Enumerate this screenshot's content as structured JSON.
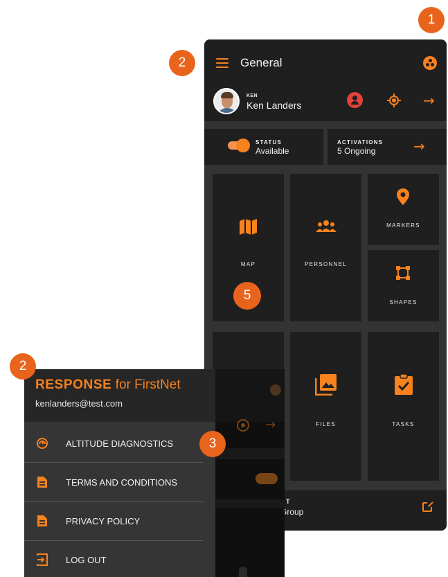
{
  "callouts": {
    "one": "1",
    "two_top": "2",
    "two_bottom": "2",
    "three": "3",
    "five": "5"
  },
  "appbar": {
    "title": "General",
    "menu_icon": "hamburger-icon",
    "group_icon": "group-icon"
  },
  "user": {
    "label": "KEN",
    "name": "Ken Landers"
  },
  "status_card": {
    "label": "STATUS",
    "value": "Available"
  },
  "activations_card": {
    "label": "ACTIVATIONS",
    "value": "5 Ongoing"
  },
  "tiles": {
    "map": "MAP",
    "personnel": "PERSONNEL",
    "markers": "MARKERS",
    "shapes": "SHAPES",
    "files": "FILES",
    "tasks": "TASKS"
  },
  "footer": {
    "label_partial": "T",
    "text_partial": "Group"
  },
  "drawer": {
    "brand_bold": "RESPONSE",
    "brand_rest": " for FirstNet",
    "email": "kenlanders@test.com",
    "items": [
      {
        "label": "ALTITUDE DIAGNOSTICS",
        "icon": "speedometer-icon"
      },
      {
        "label": "TERMS AND CONDITIONS",
        "icon": "document-icon"
      },
      {
        "label": "PRIVACY POLICY",
        "icon": "document-icon"
      },
      {
        "label": "LOG OUT",
        "icon": "logout-icon"
      }
    ]
  },
  "colors": {
    "accent": "#f7821e",
    "callout": "#e8641c",
    "panel": "#1f1f1f",
    "background": "#333333",
    "alert": "#e3423b"
  }
}
